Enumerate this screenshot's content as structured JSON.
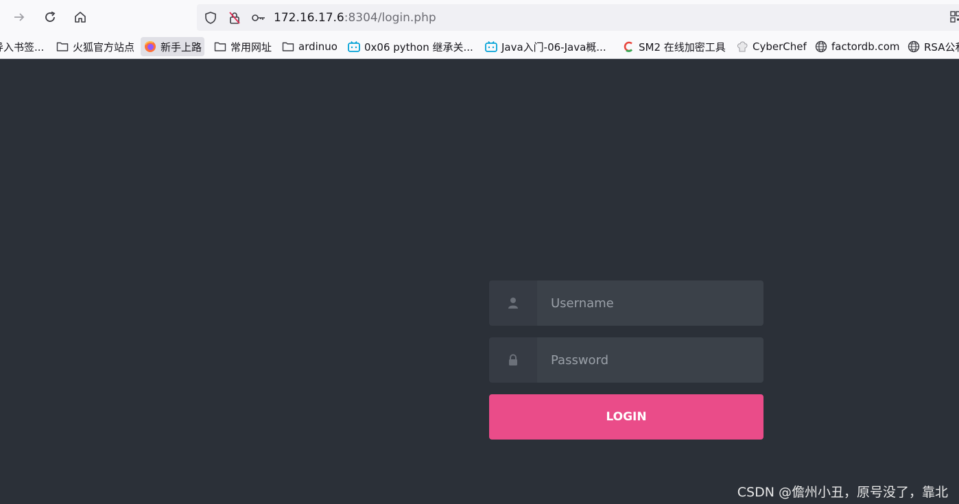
{
  "browser": {
    "url_host": "172.16.17.6",
    "url_rest": ":8304/login.php"
  },
  "bookmarks": [
    {
      "label": "导入书签...",
      "icon": "none"
    },
    {
      "label": "火狐官方站点",
      "icon": "folder-icon"
    },
    {
      "label": "新手上路",
      "icon": "firefox-icon"
    },
    {
      "label": "常用网址",
      "icon": "folder-icon"
    },
    {
      "label": "ardinuo",
      "icon": "folder-icon"
    },
    {
      "label": "0x06 python 继承关...",
      "icon": "bilibili-icon"
    },
    {
      "label": "Java入门-06-Java概...",
      "icon": "bilibili-icon"
    },
    {
      "label": "SM2 在线加密工具",
      "icon": "c-logo-icon"
    },
    {
      "label": "CyberChef",
      "icon": "chef-hat-icon"
    },
    {
      "label": "factordb.com",
      "icon": "globe-icon"
    },
    {
      "label": "RSA公私",
      "icon": "globe-icon"
    }
  ],
  "login": {
    "username_placeholder": "Username",
    "password_placeholder": "Password",
    "button_label": "LOGIN"
  },
  "watermark": "CSDN @儋州小丑，原号没了，靠北",
  "colors": {
    "background": "#2b3038",
    "button": "#ea4c89",
    "input_bg": "#3b4149",
    "icon_bg": "#363b44"
  }
}
